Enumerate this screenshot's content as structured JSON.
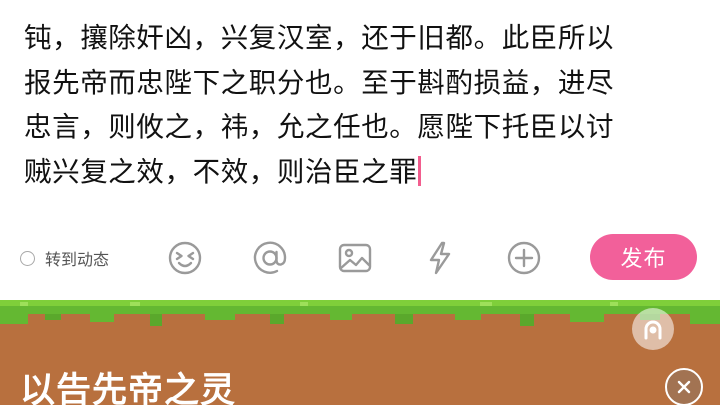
{
  "editor": {
    "lines": [
      "钝，攘除奸凶，兴复汉室，还于旧都。此臣所以",
      "报先帝而忠陛下之职分也。至于斟酌损益，进尽",
      "忠言，则攸之，祎，允之任也。愿陛下托臣以讨",
      "贼兴复之效，不效，则治臣之罪"
    ]
  },
  "toolbar": {
    "repost_label": "转到动态",
    "icons": [
      "emoji-icon",
      "mention-icon",
      "image-icon",
      "lightning-icon",
      "add-icon"
    ],
    "publish_label": "发布",
    "accent_color": "#f2609a"
  },
  "banner": {
    "text": "以告先帝之灵",
    "icons": [
      "share-icon",
      "close-icon"
    ]
  }
}
